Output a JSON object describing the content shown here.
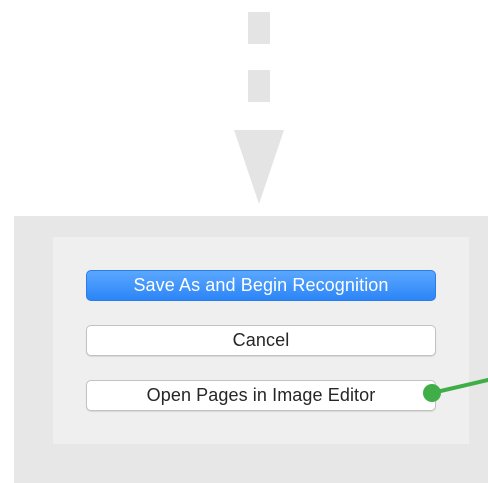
{
  "dialog": {
    "buttons": {
      "save_label": "Save As and Begin Recognition",
      "cancel_label": "Cancel",
      "open_editor_label": "Open Pages in Image Editor"
    }
  },
  "colors": {
    "accent_blue": "#2c85f7",
    "callout_green": "#3fae49",
    "arrow_gray": "#e4e4e4",
    "panel_gray": "#e7e7e7"
  },
  "icons": {
    "flow_arrow": "arrow-down-dashed-icon",
    "callout": "callout-marker-icon"
  }
}
